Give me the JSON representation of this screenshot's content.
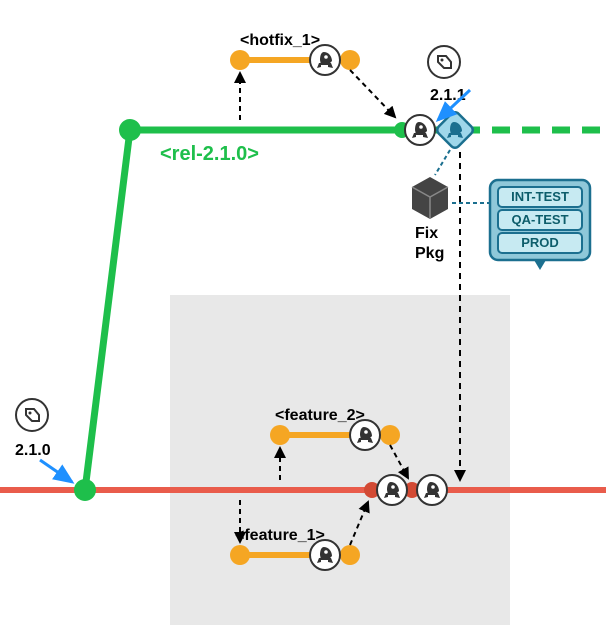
{
  "tags": {
    "left": {
      "label": "2.1.0"
    },
    "right": {
      "label": "2.1.1"
    }
  },
  "branches": {
    "release": {
      "label": "<rel-2.1.0>",
      "color": "#1ebf4b"
    },
    "hotfix": {
      "label": "<hotfix_1>",
      "color": "#f5a623"
    },
    "feature1": {
      "label": "<feature_1>",
      "color": "#f5a623"
    },
    "feature2": {
      "label": "<feature_2>",
      "color": "#f5a623"
    },
    "main": {
      "color": "#e95c4b"
    }
  },
  "package": {
    "label_line1": "Fix",
    "label_line2": "Pkg"
  },
  "environments": [
    "INT-TEST",
    "QA-TEST",
    "PROD"
  ],
  "icons": {
    "rocket": "rocket-icon",
    "tag": "tag-icon",
    "diamond_rocket": "deploy-diamond-icon"
  }
}
